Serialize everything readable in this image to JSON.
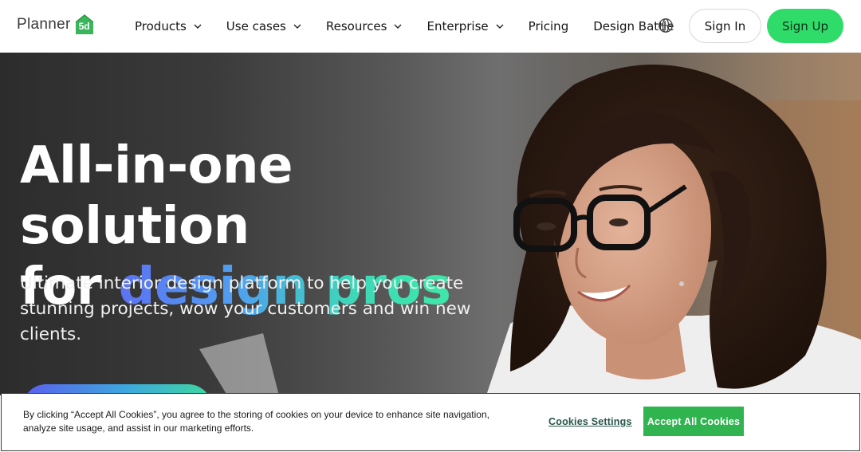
{
  "brand": {
    "name": "Planner",
    "badge": "5d",
    "badge_color": "#3bb55b"
  },
  "nav": {
    "items": [
      {
        "label": "Products",
        "has_dropdown": true
      },
      {
        "label": "Use cases",
        "has_dropdown": true
      },
      {
        "label": "Resources",
        "has_dropdown": true
      },
      {
        "label": "Enterprise",
        "has_dropdown": true
      },
      {
        "label": "Pricing",
        "has_dropdown": false
      },
      {
        "label": "Design Battle",
        "has_dropdown": false
      }
    ],
    "language_icon": "globe-icon",
    "sign_in_label": "Sign In",
    "sign_up_label": "Sign Up",
    "accent_color": "#2fdc6a"
  },
  "hero": {
    "title_line1": "All-in-one solution",
    "title_line2_plain": "for ",
    "title_line2_highlight": "design pros",
    "subtitle": "Ultimate interior design platform to help you create stunning projects, wow your customers and win new clients.",
    "gradient_colors": [
      "#5d72f2",
      "#3ed7b8"
    ]
  },
  "cookie_banner": {
    "text": "By clicking “Accept All Cookies”, you agree to the storing of cookies on your device to enhance site navigation, analyze site usage, and assist in our marketing efforts.",
    "settings_label": "Cookies Settings",
    "accept_label": "Accept All Cookies",
    "accept_color": "#2fb44f"
  }
}
